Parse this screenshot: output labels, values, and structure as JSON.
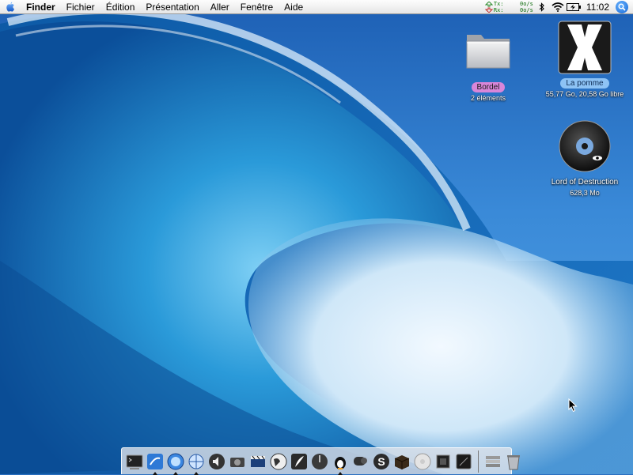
{
  "menubar": {
    "apple_icon": "apple-icon",
    "app_name": "Finder",
    "menus": [
      "Fichier",
      "Édition",
      "Présentation",
      "Aller",
      "Fenêtre",
      "Aide"
    ],
    "netmon": {
      "tx_label": "Tx:",
      "tx_value": "0o/s",
      "rx_label": "Rx:",
      "rx_value": "0o/s"
    },
    "status_icons": [
      "bluetooth-icon",
      "wifi-icon",
      "battery-icon"
    ],
    "clock": "11:02",
    "spotlight_icon": "spotlight-icon"
  },
  "desktop": {
    "icons": [
      {
        "name": "Bordel",
        "info": "2 éléments",
        "kind": "folder",
        "label_color": "#d986d9"
      },
      {
        "name": "La pomme",
        "info": "55,77 Go, 20,58 Go libre",
        "kind": "hard-drive",
        "label_color": "#8ec3f5"
      },
      {
        "name": "Lord of Destruction",
        "info": "628,3 Mo",
        "kind": "disc"
      }
    ]
  },
  "dock": {
    "items": [
      "terminal-icon",
      "finder-icon",
      "safari-icon",
      "network-icon",
      "volume-icon",
      "camera-icon",
      "imovie-icon",
      "globe-icon",
      "feather-icon",
      "clock-icon",
      "adium-icon",
      "chat-icon",
      "skype-icon",
      "box-icon",
      "ipod-icon",
      "chip-icon",
      "dark-app-icon",
      "documents-stack-icon",
      "trash-icon"
    ]
  },
  "colors": {
    "menubar": "#ececec",
    "desktop": "#2a6fc0",
    "wave": "#1f86d4",
    "foam": "#e8f3fb"
  }
}
